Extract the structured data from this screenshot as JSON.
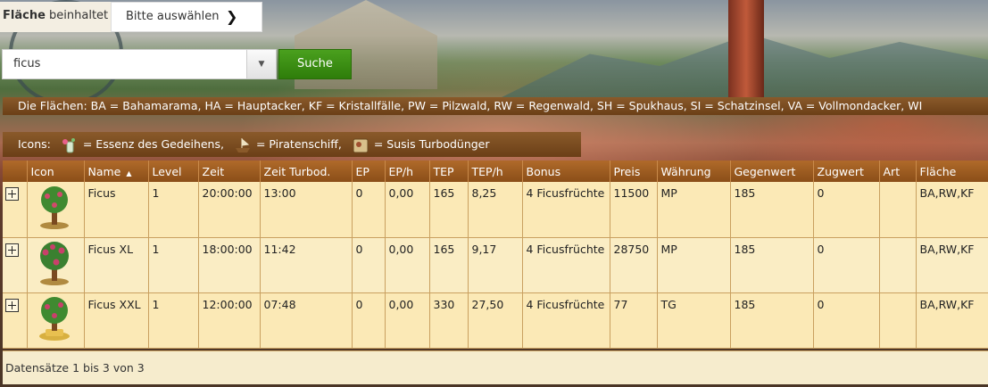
{
  "filter": {
    "label_bold": "Fläche",
    "label_rest": " beinhaltet",
    "select_value": "Bitte auswählen"
  },
  "search": {
    "value": "ficus",
    "button_label": "Suche"
  },
  "legend": {
    "text": "Die Flächen: BA = Bahamarama, HA = Hauptacker, KF = Kristallfälle, PW = Pilzwald, RW = Regenwald, SH = Spukhaus, SI = Schatzinsel, VA = Vollmondacker, WI"
  },
  "icons_legend": {
    "label": "Icons:",
    "items": [
      {
        "icon": "essence-icon",
        "text": "= Essenz des Gedeihens,"
      },
      {
        "icon": "pirate-ship-icon",
        "text": "= Piratenschiff,"
      },
      {
        "icon": "fertilizer-icon",
        "text": "= Susis Turbodünger"
      }
    ]
  },
  "table": {
    "headers": [
      "",
      "Icon",
      "Name",
      "Level",
      "Zeit",
      "Zeit Turbod.",
      "EP",
      "EP/h",
      "TEP",
      "TEP/h",
      "Bonus",
      "Preis",
      "Währung",
      "Gegenwert",
      "Zugwert",
      "Art",
      "Fläche"
    ],
    "sorted_column": "Name",
    "rows": [
      {
        "name": "Ficus",
        "level": "1",
        "zeit": "20:00:00",
        "zeit_turbo": "13:00",
        "ep": "0",
        "eph": "0,00",
        "tep": "165",
        "teph": "8,25",
        "bonus": "4 Ficusfrüchte",
        "preis": "11500",
        "waehrung": "MP",
        "gegenwert": "185",
        "zugwert": "0",
        "art": "",
        "flaeche": "BA,RW,KF"
      },
      {
        "name": "Ficus XL",
        "level": "1",
        "zeit": "18:00:00",
        "zeit_turbo": "11:42",
        "ep": "0",
        "eph": "0,00",
        "tep": "165",
        "teph": "9,17",
        "bonus": "4 Ficusfrüchte",
        "preis": "28750",
        "waehrung": "MP",
        "gegenwert": "185",
        "zugwert": "0",
        "art": "",
        "flaeche": "BA,RW,KF"
      },
      {
        "name": "Ficus XXL",
        "level": "1",
        "zeit": "12:00:00",
        "zeit_turbo": "07:48",
        "ep": "0",
        "eph": "0,00",
        "tep": "330",
        "teph": "27,50",
        "bonus": "4 Ficusfrüchte",
        "preis": "77",
        "waehrung": "TG",
        "gegenwert": "185",
        "zugwert": "0",
        "art": "",
        "flaeche": "BA,RW,KF"
      }
    ]
  },
  "footer": {
    "text": "Datensätze 1 bis 3 von 3"
  }
}
